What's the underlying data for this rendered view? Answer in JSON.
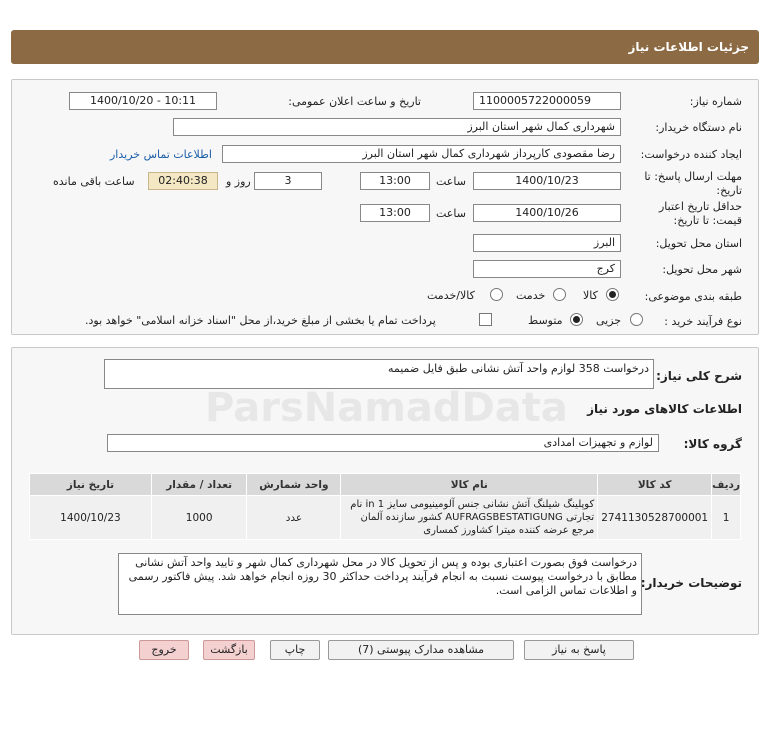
{
  "header": {
    "title": "جزئیات اطلاعات نیاز"
  },
  "form": {
    "need_number_label": "شماره نیاز:",
    "need_number": "1100005722000059",
    "announce_label": "تاریخ و ساعت اعلان عمومی:",
    "announce_value": "1400/10/20 - 10:11",
    "buyer_org_label": "نام دستگاه خریدار:",
    "buyer_org": "شهرداری کمال شهر استان البرز",
    "requester_label": "ایجاد کننده درخواست:",
    "requester": "رضا مقصودی کارپرداز شهرداری کمال شهر استان البرز",
    "contact_link": "اطلاعات تماس خریدار",
    "deadline_label": "مهلت ارسال پاسخ: تا تاریخ:",
    "deadline_date": "1400/10/23",
    "time_label": "ساعت",
    "deadline_time": "13:00",
    "days": "3",
    "days_label": "روز و",
    "remaining_time": "02:40:38",
    "remaining_label": "ساعت باقی مانده",
    "validity_label": "حداقل تاریخ اعتبار قیمت: تا تاریخ:",
    "validity_date": "1400/10/26",
    "validity_time": "13:00",
    "province_label": "استان محل تحویل:",
    "province": "البرز",
    "city_label": "شهر محل تحویل:",
    "city": "کرج",
    "category_label": "طبقه بندی موضوعی:",
    "category_options": [
      "کالا",
      "خدمت",
      "کالا/خدمت"
    ],
    "process_label": "نوع فرآیند خرید :",
    "process_options": [
      "جزیی",
      "متوسط"
    ],
    "payment_note": "پرداخت تمام یا بخشی از مبلغ خرید،از محل \"اسناد خزانه اسلامی\" خواهد بود."
  },
  "details": {
    "summary_label": "شرح کلی نیاز:",
    "summary": "درخواست 358 لوازم واحد آتش نشانی طبق فایل ضمیمه",
    "goods_info_title": "اطلاعات کالاهای مورد نیاز",
    "goods_group_label": "گروه کالا:",
    "goods_group": "لوازم و تجهیزات امدادی",
    "table": {
      "headers": [
        "ردیف",
        "کد کالا",
        "نام کالا",
        "واحد شمارش",
        "تعداد / مقدار",
        "تاریخ نیاز"
      ],
      "rows": [
        {
          "row": "1",
          "code": "2741130528700001",
          "name": "کوپلینگ شیلنگ آتش نشانی جنس آلومینیومی سایز 1 in نام تجارتی AUFRAGSBESTATIGUNG کشور سازنده آلمان مرجع عرضه کننده میترا کشاورز کمساری",
          "unit": "عدد",
          "qty": "1000",
          "date": "1400/10/23"
        }
      ]
    },
    "buyer_desc_label": "توضیحات خریدار:",
    "buyer_desc": "درخواست فوق بصورت اعتباری بوده و پس از تحویل  کالا در محل شهرداری کمال شهر و تایید واحد آتش نشانی مطابق با درخواست پیوست نسبت به انجام فرآیند پرداخت حداکثر 30 روزه انجام خواهد شد. پیش فاکتور رسمی و اطلاعات تماس الزامی است."
  },
  "buttons": {
    "reply": "پاسخ به نیاز",
    "attachments": "مشاهده مدارک پیوستی (7)",
    "print": "چاپ",
    "back": "بازگشت",
    "exit": "خروج"
  },
  "colors": {
    "header_bg": "#8c6a43",
    "link": "#1a5ea8",
    "remaining_bg": "#f3e7c4",
    "exit_bg": "#f5d0d0"
  }
}
